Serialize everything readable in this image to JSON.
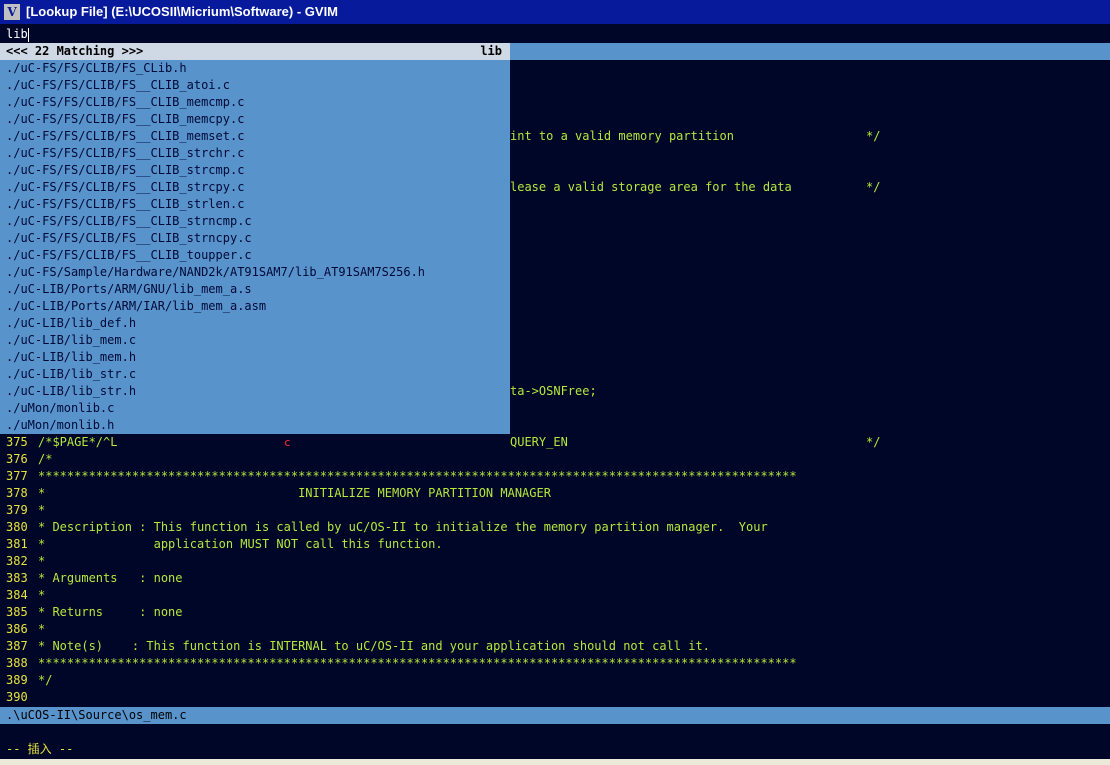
{
  "window": {
    "title": "[Lookup File] (E:\\UCOSII\\Micrium\\Software) - GVIM",
    "app_icon": "vim-icon"
  },
  "prompt": {
    "value": "lib"
  },
  "lookup": {
    "header": "<<< 22 Matching >>>",
    "pattern": "lib",
    "items": [
      "./uC-FS/FS/CLIB/FS_CLib.h",
      "./uC-FS/FS/CLIB/FS__CLIB_atoi.c",
      "./uC-FS/FS/CLIB/FS__CLIB_memcmp.c",
      "./uC-FS/FS/CLIB/FS__CLIB_memcpy.c",
      "./uC-FS/FS/CLIB/FS__CLIB_memset.c",
      "./uC-FS/FS/CLIB/FS__CLIB_strchr.c",
      "./uC-FS/FS/CLIB/FS__CLIB_strcmp.c",
      "./uC-FS/FS/CLIB/FS__CLIB_strcpy.c",
      "./uC-FS/FS/CLIB/FS__CLIB_strlen.c",
      "./uC-FS/FS/CLIB/FS__CLIB_strncmp.c",
      "./uC-FS/FS/CLIB/FS__CLIB_strncpy.c",
      "./uC-FS/FS/CLIB/FS__CLIB_toupper.c",
      "./uC-FS/Sample/Hardware/NAND2k/AT91SAM7/lib_AT91SAM7S256.h",
      "./uC-LIB/Ports/ARM/GNU/lib_mem_a.s",
      "./uC-LIB/Ports/ARM/IAR/lib_mem_a.asm",
      "./uC-LIB/lib_def.h",
      "./uC-LIB/lib_mem.c",
      "./uC-LIB/lib_mem.h",
      "./uC-LIB/lib_str.c",
      "./uC-LIB/lib_str.h",
      "./uMon/monlib.c",
      "./uMon/monlib.h"
    ]
  },
  "behind_text": [
    {
      "text": "int to a valid memory partition",
      "tail": "*/"
    },
    {
      "text": "lease a valid storage area for the data",
      "tail": "*/"
    },
    {
      "text": "ta->OSNFree;",
      "tail": ""
    },
    {
      "text": "QUERY_EN",
      "tail": "*/"
    }
  ],
  "code_lines": [
    {
      "num": "375",
      "text": "/*$PAGE*/^L"
    },
    {
      "num": "376",
      "text": "/*"
    },
    {
      "num": "377",
      "text": "*********************************************************************************************************"
    },
    {
      "num": "378",
      "text": "*                                   INITIALIZE MEMORY PARTITION MANAGER"
    },
    {
      "num": "379",
      "text": "*"
    },
    {
      "num": "380",
      "text": "* Description : This function is called by uC/OS-II to initialize the memory partition manager.  Your"
    },
    {
      "num": "381",
      "text": "*               application MUST NOT call this function."
    },
    {
      "num": "382",
      "text": "*"
    },
    {
      "num": "383",
      "text": "* Arguments   : none"
    },
    {
      "num": "384",
      "text": "*"
    },
    {
      "num": "385",
      "text": "* Returns     : none"
    },
    {
      "num": "386",
      "text": "*"
    },
    {
      "num": "387",
      "text": "* Note(s)    : This function is INTERNAL to uC/OS-II and your application should not call it."
    },
    {
      "num": "388",
      "text": "*********************************************************************************************************"
    },
    {
      "num": "389",
      "text": "*/"
    },
    {
      "num": "390",
      "text": ""
    }
  ],
  "red_mark": "c",
  "status": {
    "file": ".\\uCOS-II\\Source\\os_mem.c"
  },
  "mode": "-- 插入 --",
  "colors": {
    "background": "#000628",
    "lookup_bg": "#5893cc",
    "code_green": "#b6e83a",
    "line_number_yellow": "#e8e23c",
    "titlebar": "#081a9c"
  }
}
